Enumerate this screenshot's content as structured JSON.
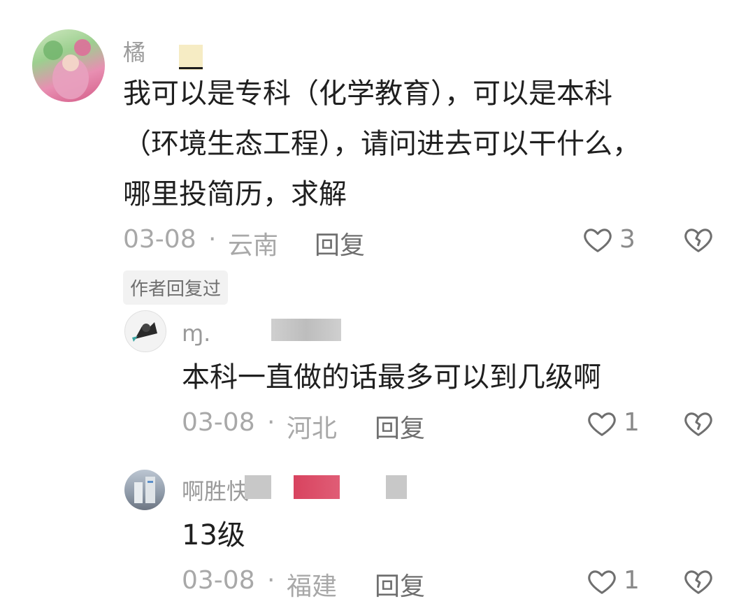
{
  "comment": {
    "author": "橘",
    "text_lines": [
      "我可以是专科（化学教育），可以是本科",
      "（环境生态工程），请问进去可以干什么，",
      "哪里投简历，求解"
    ],
    "date": "03-08",
    "location": "云南",
    "reply_label": "回复",
    "like_count": "3",
    "author_replied_badge": "作者回复过"
  },
  "replies": [
    {
      "author": "ɱ.",
      "text": "本科一直做的话最多可以到几级啊",
      "date": "03-08",
      "location": "河北",
      "reply_label": "回复",
      "like_count": "1"
    },
    {
      "author": "啊胜快",
      "text": "13级",
      "date": "03-08",
      "location": "福建",
      "reply_label": "回复",
      "like_count": "1"
    }
  ],
  "separator": "·",
  "icons": {
    "like": "heart-outline-icon",
    "dislike": "broken-heart-icon"
  }
}
